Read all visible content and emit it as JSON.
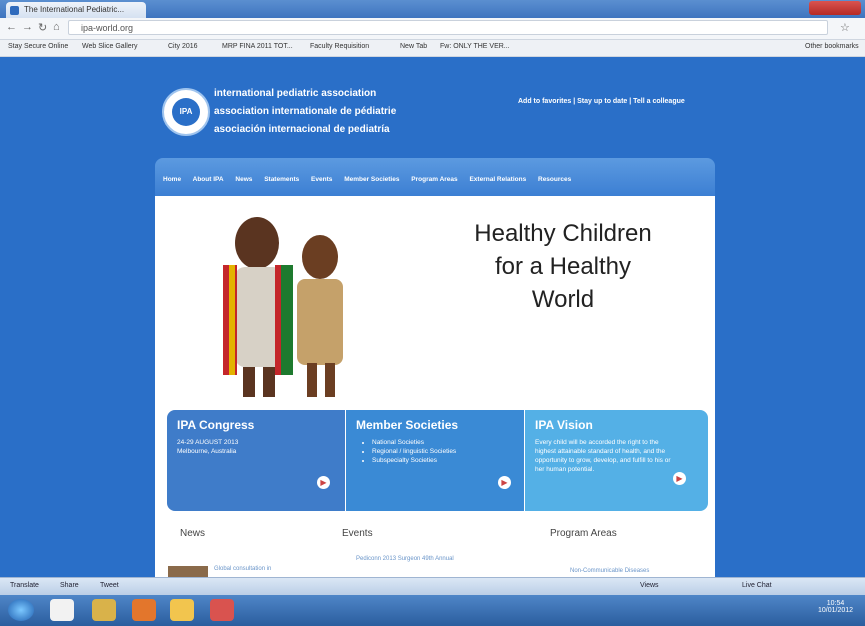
{
  "browser": {
    "tab_title": "The International Pediatric...",
    "address": "ipa-world.org",
    "bookmarks": [
      "Stay Secure Online",
      "Web Slice Gallery",
      "City 2016",
      "MRP FINA 2011 TOT...",
      "Faculty Requisition",
      "New Tab",
      "Fw: ONLY THE VER...",
      "Other bookmarks"
    ]
  },
  "header": {
    "logo_text": "IPA",
    "org_lines": [
      "international pediatric association",
      "association internationale de pédiatrie",
      "asociación internacional de pediatría"
    ],
    "top_links": "Add to favorites | Stay up to date | Tell a colleague"
  },
  "main_nav": [
    "Home",
    "About IPA",
    "News",
    "Statements",
    "Events",
    "Member Societies",
    "Program Areas",
    "External Relations",
    "Resources"
  ],
  "hero": {
    "tagline_lines": [
      "Healthy Children",
      "for a Healthy",
      "World"
    ]
  },
  "boxes": {
    "congress": {
      "title": "IPA Congress",
      "lines": [
        "24-29 AUGUST 2013",
        "Melbourne, Australia"
      ]
    },
    "societies": {
      "title": "Member Societies",
      "items": [
        "National Societies",
        "Regional / linguistic Societies",
        "Subspecialty Societies"
      ]
    },
    "vision": {
      "title": "IPA Vision",
      "text": "Every child will be accorded the right to the highest attainable standard of health, and the opportunity to grow, develop, and fulfill to his or her human potential."
    }
  },
  "sections": {
    "news": "News",
    "events": "Events",
    "program_areas": "Program Areas",
    "news_item": "Global consultation in",
    "event_item": "Pediconn 2013 Surgeon 49th Annual",
    "program_item": "Non-Communicable Diseases"
  },
  "statusbar": {
    "items": [
      "Translate",
      "Share",
      "Tweet",
      "Views",
      "Live Chat"
    ]
  },
  "taskbar": {
    "time": "10:54",
    "date": "10/01/2012"
  },
  "colors": {
    "page_bg": "#2a6fc8",
    "box_congress": "#3f7cc9",
    "box_societies": "#3a8ad5",
    "box_vision": "#54b0e6"
  }
}
